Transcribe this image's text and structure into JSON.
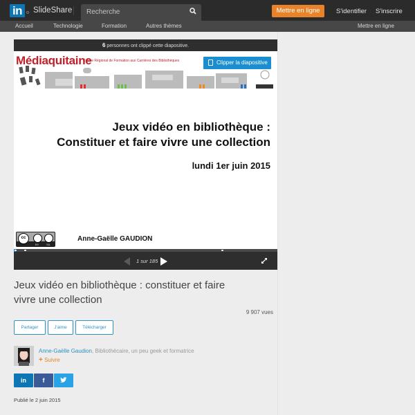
{
  "header": {
    "logo_mark": "in",
    "brand": "SlideShare",
    "search_placeholder": "Recherche",
    "upload_label": "Mettre en ligne",
    "signin_label": "S'identifier",
    "signup_label": "S'inscrire",
    "accent_color": "#e9832a"
  },
  "nav": {
    "items": [
      {
        "label": "Accueil"
      },
      {
        "label": "Technologie"
      },
      {
        "label": "Formation"
      },
      {
        "label": "Autres thèmes"
      }
    ],
    "right_label": "Mettre en ligne"
  },
  "player": {
    "clip_count": "6",
    "clip_text": " personnes ont clippé cette diapositive.",
    "clipper_label": "Clipper la diapositive",
    "current_page": 1,
    "total_pages": 185,
    "page_indicator": "1 sur 185",
    "progress_fraction": 0.0054,
    "slide": {
      "brand": "Médiaquitaine",
      "subtitle": "Centre Régional de Formation aux Carrières des Bibliothèques",
      "title_line1": "Jeux vidéo en bibliothèque :",
      "title_line2": "Constituer et faire vivre une collection",
      "date": "lundi 1er juin 2015",
      "author": "Anne-Gaëlle GAUDION",
      "license": {
        "cc": "cc",
        "by": "BY",
        "sa": "SA"
      }
    }
  },
  "document": {
    "title": "Jeux vidéo en bibliothèque : constituer et faire vivre une collection",
    "views": "9 907 vues",
    "actions": [
      {
        "label": "Partager"
      },
      {
        "label": "J'aime"
      },
      {
        "label": "Télécharger"
      }
    ],
    "author": {
      "name": "Anne-Gaëlle Gaudion",
      "bio": ", Bibliothécaire, un peu geek et formatrice",
      "follow_label": "Suivre"
    },
    "social": [
      {
        "name": "linkedin",
        "glyph": "in",
        "color": "#0e76b3"
      },
      {
        "name": "facebook",
        "glyph": "f",
        "color": "#3b5a98"
      },
      {
        "name": "twitter",
        "glyph": "t",
        "color": "#2aa3e6"
      }
    ],
    "published": "Publié le 2 juin 2015"
  }
}
